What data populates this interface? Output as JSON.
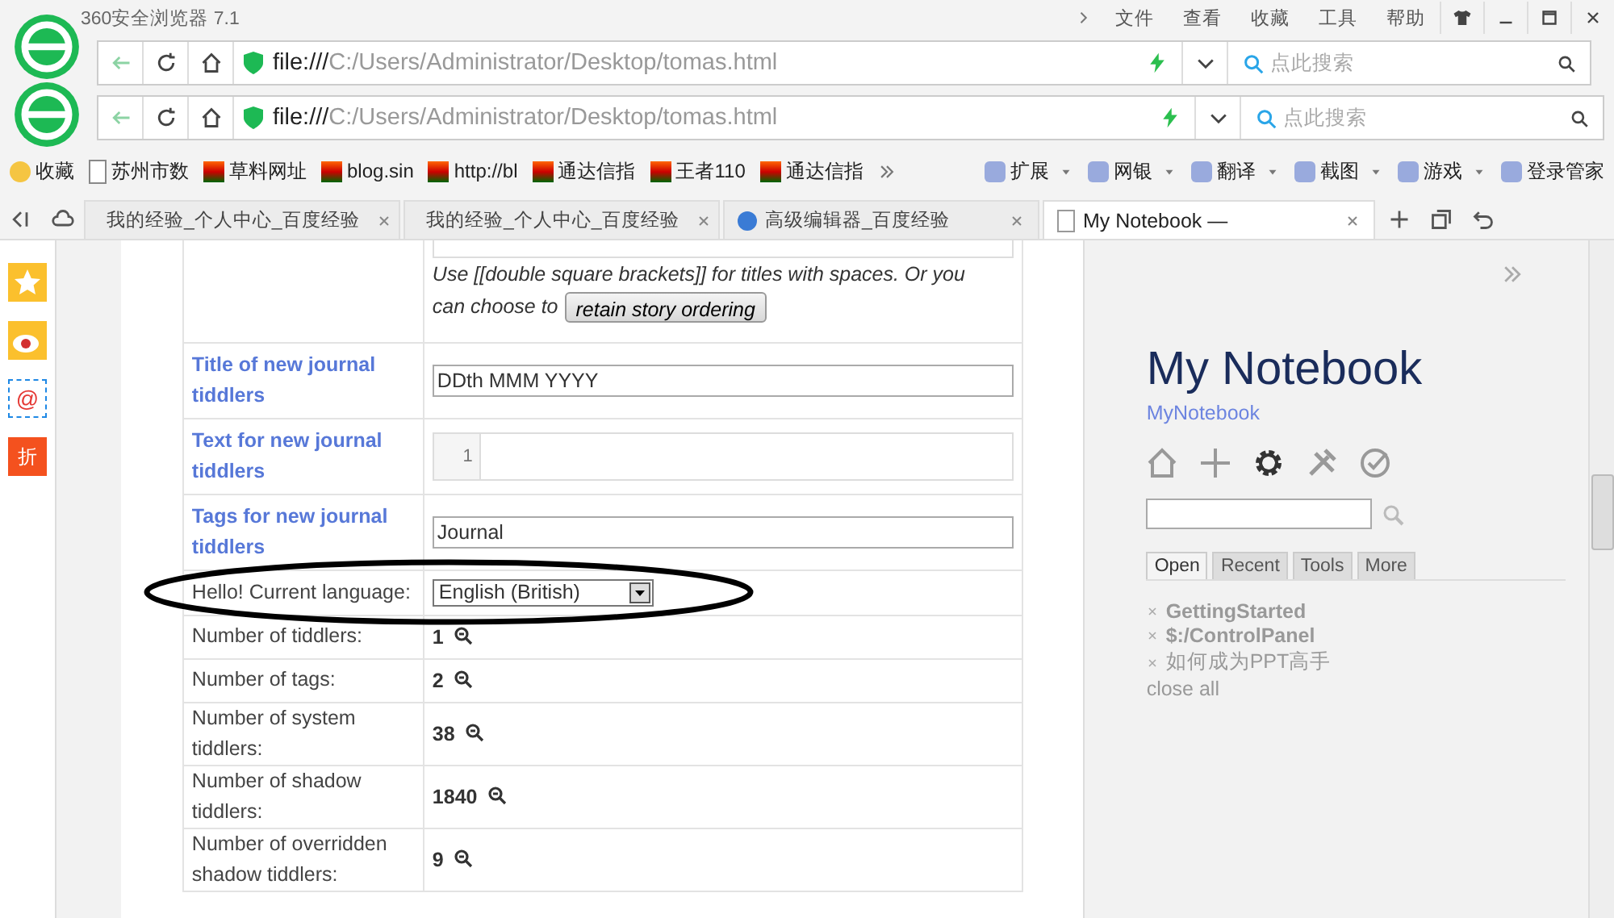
{
  "browser": {
    "title": "360安全浏览器 7.1",
    "menu": [
      "文件",
      "查看",
      "收藏",
      "工具",
      "帮助"
    ],
    "address_bars": [
      {
        "scheme": "file:///",
        "path": "C:/Users/Administrator/Desktop/tomas.html",
        "search_placeholder": "点此搜索"
      },
      {
        "scheme": "file:///",
        "path": "C:/Users/Administrator/Desktop/tomas.html",
        "search_placeholder": "点此搜索"
      }
    ],
    "bookmarks": [
      "收藏",
      "苏州市数",
      "草料网址",
      "blog.sin",
      "http://bl",
      "通达信指",
      "王者110",
      "通达信指"
    ],
    "tools": [
      "扩展",
      "网银",
      "翻译",
      "截图",
      "游戏",
      "登录管家"
    ],
    "tabs": [
      {
        "label": "我的经验_个人中心_百度经验",
        "selected": false
      },
      {
        "label": "我的经验_个人中心_百度经验",
        "selected": false
      },
      {
        "label": "高级编辑器_百度经验",
        "selected": false
      },
      {
        "label": "My Notebook —",
        "selected": true
      }
    ]
  },
  "sidebar": {
    "mail_glyph": "@",
    "discount_glyph": "折"
  },
  "control_panel": {
    "rows": [
      {
        "kind": "list",
        "note_lines": [
          "Use [[double square brackets]] for titles with spaces. Or you",
          "can choose to"
        ],
        "button": "retain story ordering"
      },
      {
        "kind": "input",
        "label": "Title of new journal tiddlers",
        "value": "DDth MMM YYYY"
      },
      {
        "kind": "editor",
        "label": "Text for new journal tiddlers",
        "line_number": "1"
      },
      {
        "kind": "input",
        "label": "Tags for new journal tiddlers",
        "value": "Journal"
      },
      {
        "kind": "select",
        "label": "Hello! Current language:",
        "value": "English (British)"
      },
      {
        "kind": "stat",
        "label": "Number of tiddlers:",
        "value": "1"
      },
      {
        "kind": "stat",
        "label": "Number of tags:",
        "value": "2"
      },
      {
        "kind": "stat",
        "label": "Number of system tiddlers:",
        "value": "38"
      },
      {
        "kind": "stat",
        "label": "Number of shadow tiddlers:",
        "value": "1840"
      },
      {
        "kind": "stat",
        "label": "Number of overridden shadow tiddlers:",
        "value": "9"
      }
    ]
  },
  "notebook": {
    "title": "My Notebook",
    "subtitle": "MyNotebook",
    "tabs": [
      {
        "label": "Open",
        "selected": true
      },
      {
        "label": "Recent",
        "selected": false
      },
      {
        "label": "Tools",
        "selected": false
      },
      {
        "label": "More",
        "selected": false
      }
    ],
    "open_items": [
      {
        "label": "GettingStarted",
        "bold": true
      },
      {
        "label": "$:/ControlPanel",
        "bold": true
      },
      {
        "label": "如何成为PPT高手",
        "bold": false
      }
    ],
    "close_all": "close all"
  }
}
